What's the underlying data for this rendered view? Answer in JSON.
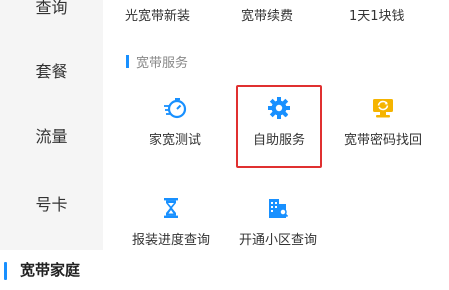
{
  "sidebar": {
    "items": [
      {
        "label": "查询"
      },
      {
        "label": "套餐"
      },
      {
        "label": "流量"
      },
      {
        "label": "号卡"
      },
      {
        "label": "宽带家庭"
      }
    ]
  },
  "top_links": [
    "光宽带新装",
    "宽带续费",
    "1天1块钱"
  ],
  "section": {
    "title": "宽带服务"
  },
  "services": [
    {
      "label": "家宽测试",
      "icon": "speed-test-icon"
    },
    {
      "label": "自助服务",
      "icon": "gear-self-service-icon"
    },
    {
      "label": "宽带密码找回",
      "icon": "password-recovery-icon"
    },
    {
      "label": "报装进度查询",
      "icon": "hourglass-icon"
    },
    {
      "label": "开通小区查询",
      "icon": "building-search-icon"
    }
  ],
  "colors": {
    "accent": "#1890ff",
    "highlight_border": "#e03030",
    "icon_yellow": "#f5b400"
  }
}
